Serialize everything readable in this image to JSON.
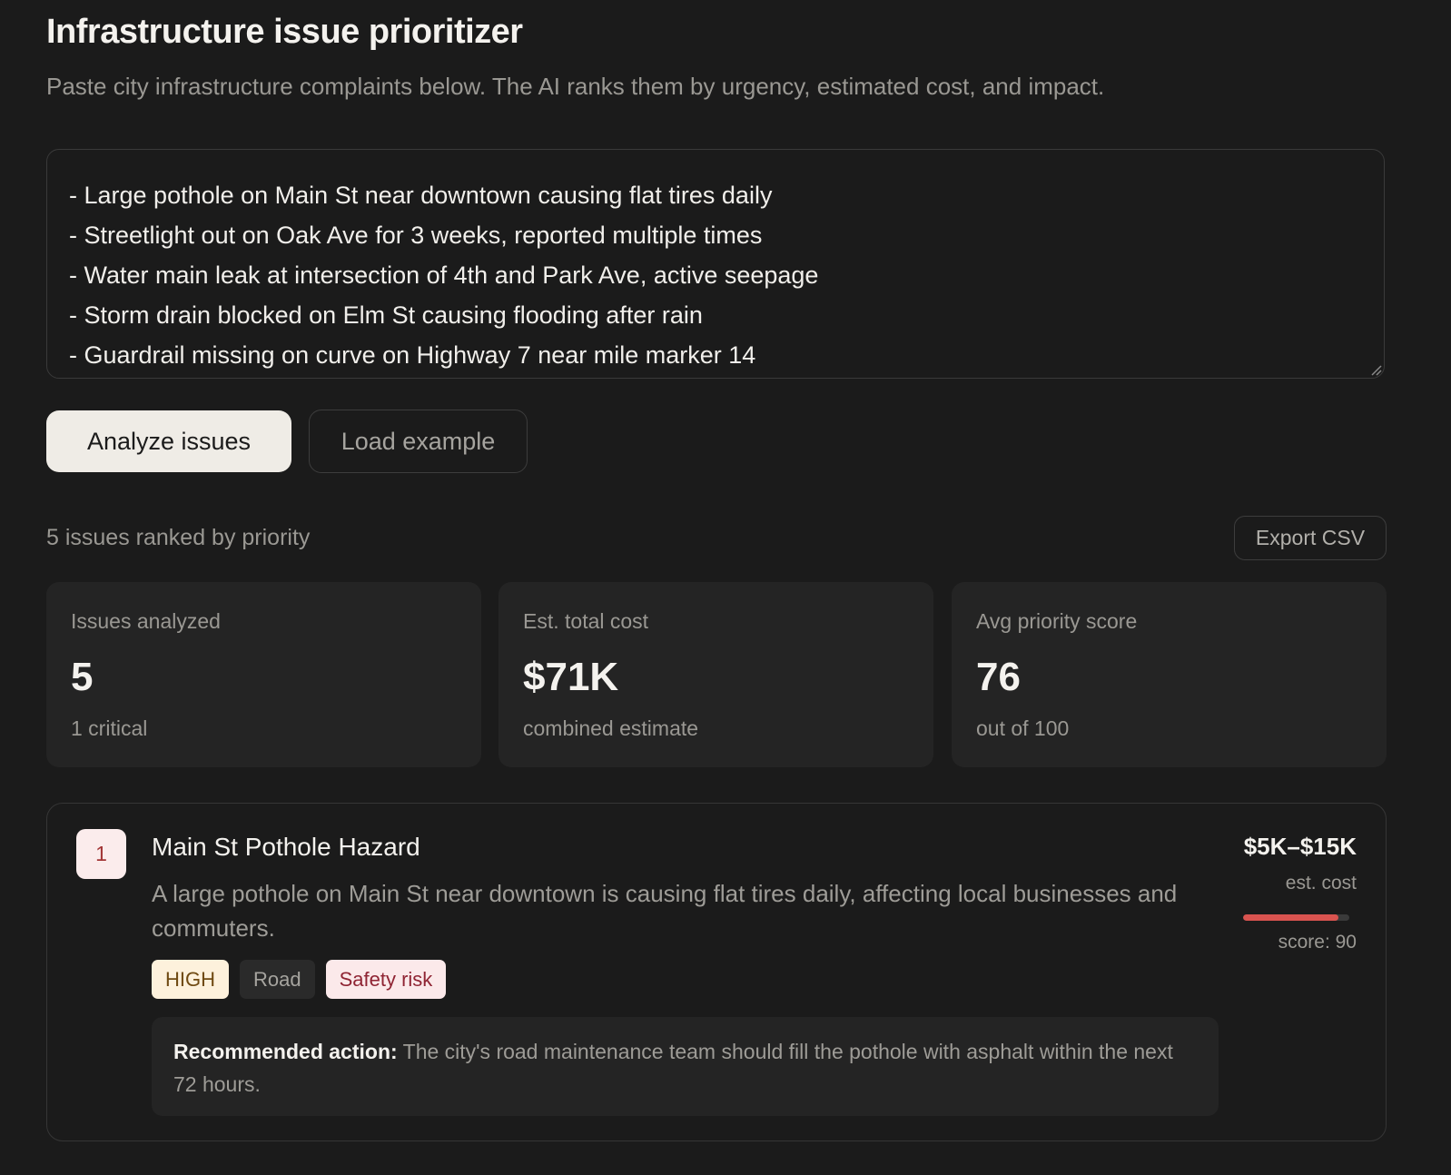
{
  "header": {
    "title": "Infrastructure issue prioritizer",
    "subtitle": "Paste city infrastructure complaints below. The AI ranks them by urgency, estimated cost, and impact."
  },
  "input": {
    "lines": [
      "- Large pothole on Main St near downtown causing flat tires daily",
      "- Streetlight out on Oak Ave for 3 weeks, reported multiple times",
      "- Water main leak at intersection of 4th and Park Ave, active seepage",
      "- Storm drain blocked on Elm St causing flooding after rain",
      "- Guardrail missing on curve on Highway 7 near mile marker 14"
    ]
  },
  "actions": {
    "analyze_label": "Analyze issues",
    "load_example_label": "Load example"
  },
  "results": {
    "summary": "5 issues ranked by priority",
    "export_label": "Export CSV"
  },
  "stats": [
    {
      "label": "Issues analyzed",
      "value": "5",
      "sub": "1 critical"
    },
    {
      "label": "Est. total cost",
      "value": "$71K",
      "sub": "combined estimate"
    },
    {
      "label": "Avg priority score",
      "value": "76",
      "sub": "out of 100"
    }
  ],
  "issues": [
    {
      "rank": "1",
      "title": "Main St Pothole Hazard",
      "description": "A large pothole on Main St near downtown is causing flat tires daily, affecting local businesses and commuters.",
      "tags": {
        "urgency": "HIGH",
        "category": "Road",
        "risk": "Safety risk"
      },
      "action_label": "Recommended action:",
      "action_text": "The city's road maintenance team should fill the pothole with asphalt within the next 72 hours.",
      "cost_range": "$5K–$15K",
      "cost_label": "est. cost",
      "score": 90,
      "score_label": "score: 90"
    }
  ],
  "colors": {
    "background": "#1b1b1b",
    "card": "#242424",
    "accent_score": "#d9534f",
    "primary_button": "#efece6"
  }
}
